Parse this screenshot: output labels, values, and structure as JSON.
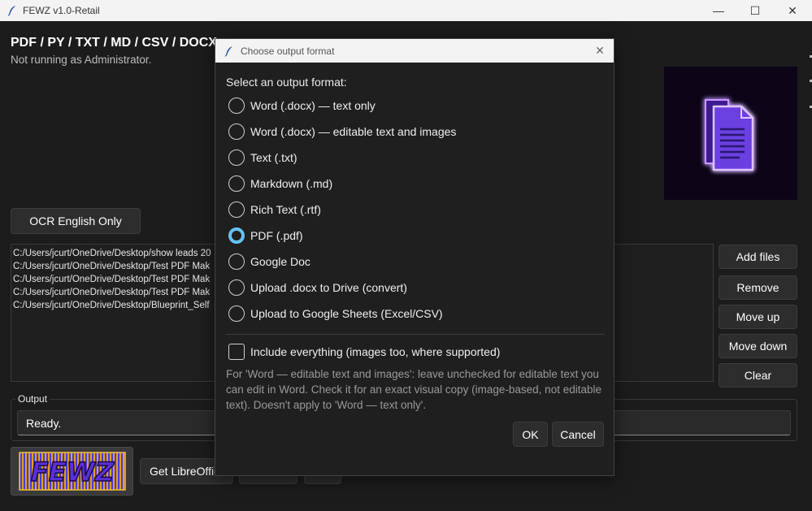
{
  "window": {
    "title": "FEWZ v1.0-Retail",
    "controls": {
      "minimize": "—",
      "maximize": "☐",
      "close": "✕"
    }
  },
  "main": {
    "heading": "PDF / PY / TXT / MD / CSV / DOCX",
    "status_line": "Not running as Administrator.",
    "ocr_button": "OCR English Only",
    "files": [
      "C:/Users/jcurt/OneDrive/Desktop/show leads 20",
      "C:/Users/jcurt/OneDrive/Desktop/Test PDF Mak",
      "C:/Users/jcurt/OneDrive/Desktop/Test PDF Mak",
      "C:/Users/jcurt/OneDrive/Desktop/Test PDF Mak",
      "C:/Users/jcurt/OneDrive/Desktop/Blueprint_Self"
    ],
    "side_buttons": {
      "add": "Add files",
      "remove": "Remove",
      "move_up": "Move up",
      "move_down": "Move down",
      "clear": "Clear"
    },
    "output": {
      "label": "Output",
      "value": "Ready."
    },
    "bottom": {
      "logo_text": "FEWZ",
      "libreoffice_button": "Get LibreOffic"
    }
  },
  "dialog": {
    "title": "Choose output format",
    "close": "✕",
    "prompt": "Select an output format:",
    "options": [
      {
        "label": "Word (.docx) — text only",
        "checked": false
      },
      {
        "label": "Word (.docx) — editable text and images",
        "checked": false
      },
      {
        "label": "Text (.txt)",
        "checked": false
      },
      {
        "label": "Markdown (.md)",
        "checked": false
      },
      {
        "label": "Rich Text (.rtf)",
        "checked": false
      },
      {
        "label": "PDF (.pdf)",
        "checked": true
      },
      {
        "label": "Google Doc",
        "checked": false
      },
      {
        "label": "Upload .docx to Drive (convert)",
        "checked": false
      },
      {
        "label": "Upload to Google Sheets (Excel/CSV)",
        "checked": false
      }
    ],
    "include_everything": {
      "label": "Include everything (images too, where supported)",
      "checked": false
    },
    "help_text": "For 'Word — editable text and images': leave unchecked for editable text you can edit in Word. Check it for an exact visual copy (image-based, not editable text). Doesn't apply to 'Word — text only'.",
    "ok": "OK",
    "cancel": "Cancel"
  },
  "colors": {
    "accent_radio": "#66c2f2",
    "logo_glow": "#b56cff",
    "logo_fill": "#6a3fe0"
  }
}
